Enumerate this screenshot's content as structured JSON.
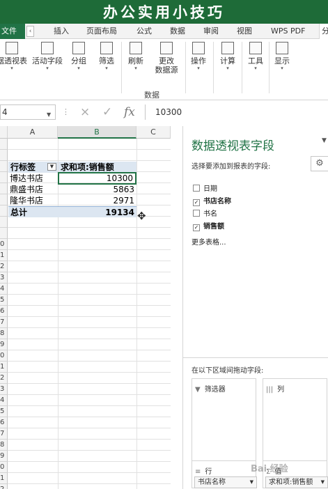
{
  "banner": {
    "title": "办公实用小技巧"
  },
  "tabs": {
    "file": "文件",
    "scroll_left": "‹",
    "items": [
      "插入",
      "页面布局",
      "公式",
      "数据",
      "审阅",
      "视图",
      "WPS PDF"
    ],
    "partial": "分"
  },
  "ribbon": {
    "buttons": [
      {
        "label": "据透视表",
        "icon": "pivottable-icon"
      },
      {
        "label": "活动字段",
        "icon": "active-field-icon"
      },
      {
        "label": "分组",
        "icon": "group-icon"
      },
      {
        "label": "筛选",
        "icon": "filter-icon"
      },
      {
        "label": "刷新",
        "icon": "refresh-icon"
      },
      {
        "label": "更改",
        "label2": "数据源",
        "icon": "change-source-icon"
      },
      {
        "label": "操作",
        "icon": "actions-icon"
      },
      {
        "label": "计算",
        "icon": "calculations-icon"
      },
      {
        "label": "工具",
        "icon": "tools-icon"
      },
      {
        "label": "显示",
        "icon": "show-icon"
      }
    ],
    "group_data_label": "数据"
  },
  "formula_bar": {
    "name_box": "4",
    "cancel_icon": "×",
    "enter_icon": "✓",
    "fx": "fx",
    "value": "10300"
  },
  "sheet": {
    "columns": [
      "A",
      "B",
      "C"
    ],
    "row_numbers": [
      "0",
      "1",
      "2",
      "3",
      "4",
      "5",
      "6",
      "7",
      "8",
      "9",
      "0",
      "1",
      "2",
      "3",
      "4",
      "5",
      "6",
      "7",
      "8",
      "9",
      "0",
      "1",
      "2"
    ],
    "pivot": {
      "header_label": "行标签",
      "header_value": "求和项:销售额",
      "rows": [
        {
          "name": "博达书店",
          "value": "10300"
        },
        {
          "name": "鼎盛书店",
          "value": "5863"
        },
        {
          "name": "隆华书店",
          "value": "2971"
        }
      ],
      "total_label": "总计",
      "total_value": "19134"
    },
    "cursor_icon": "✥"
  },
  "field_pane": {
    "title": "数据透视表字段",
    "close": "▼",
    "subtitle": "选择要添加到报表的字段:",
    "gear": "⚙",
    "fields": [
      {
        "label": "日期",
        "checked": ""
      },
      {
        "label": "书店名称",
        "checked": "✓"
      },
      {
        "label": "书名",
        "checked": ""
      },
      {
        "label": "销售额",
        "checked": "✓"
      }
    ],
    "more_tables": "更多表格...",
    "drag_hint": "在以下区域间拖动字段:",
    "areas": {
      "filters": {
        "icon": "▼",
        "label": "筛选器"
      },
      "columns": {
        "icon": "|||",
        "label": "列"
      },
      "rows": {
        "icon": "≡",
        "label": "行",
        "pill": "书店名称"
      },
      "values": {
        "icon": "Σ",
        "label": "值",
        "pill": "求和项:销售额"
      }
    }
  },
  "watermark": "Bai 经验"
}
